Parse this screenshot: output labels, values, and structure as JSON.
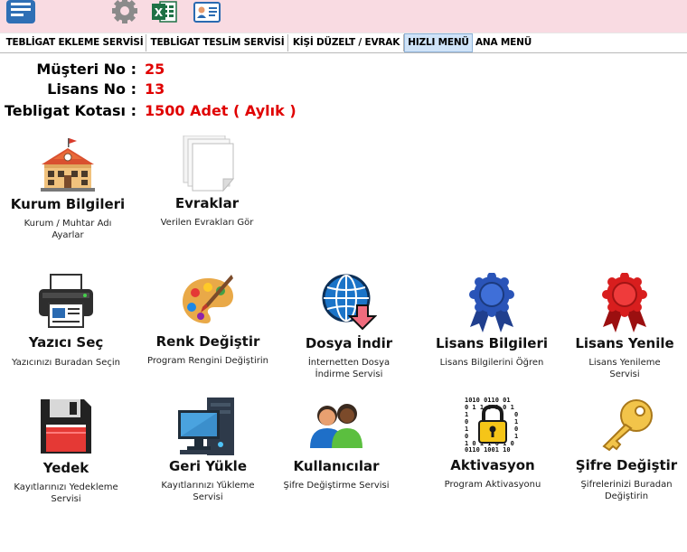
{
  "tabs": [
    {
      "label": "TEBLİGAT EKLEME SERVİSİ"
    },
    {
      "label": "TEBLİGAT TESLİM SERVİSİ"
    },
    {
      "label": "KİŞİ DÜZELT / EVRAK"
    },
    {
      "label": "HIZLI MENÜ"
    },
    {
      "label": "ANA MENÜ"
    }
  ],
  "info": {
    "customer_label": "Müşteri No :",
    "customer_value": "25",
    "license_label": "Lisans No :",
    "license_value": "13",
    "quota_label": "Tebligat Kotası :",
    "quota_value": "1500 Adet ( Aylık )"
  },
  "tiles": [
    {
      "title": "Kurum Bilgileri",
      "desc": "Kurum / Muhtar Adı Ayarlar"
    },
    {
      "title": "Evraklar",
      "desc": "Verilen Evrakları Gör"
    },
    {
      "title": "Yazıcı Seç",
      "desc": "Yazıcınızı Buradan Seçin"
    },
    {
      "title": "Renk Değiştir",
      "desc": "Program Rengini Değiştirin"
    },
    {
      "title": "Dosya İndir",
      "desc": "İnternetten Dosya İndirme Servisi"
    },
    {
      "title": "Lisans Bilgileri",
      "desc": "Lisans Bilgilerini Öğren"
    },
    {
      "title": "Lisans Yenile",
      "desc": "Lisans Yenileme Servisi"
    },
    {
      "title": "Yedek",
      "desc": "Kayıtlarınızı Yedekleme Servisi"
    },
    {
      "title": "Geri Yükle",
      "desc": "Kayıtlarınızı Yükleme Servisi"
    },
    {
      "title": "Kullanıcılar",
      "desc": "Şifre Değiştirme Servisi"
    },
    {
      "title": "Aktivasyon",
      "desc": "Program Aktivasyonu"
    },
    {
      "title": "Şifre Değiştir",
      "desc": "Şifrelerinizi Buradan Değiştirin"
    }
  ],
  "icons": [
    "mail-icon",
    "gear-icon",
    "excel-icon",
    "id-card-icon",
    "school-building-icon",
    "documents-icon",
    "printer-icon",
    "palette-icon",
    "globe-download-icon",
    "blue-award-icon",
    "red-award-icon",
    "floppy-disk-icon",
    "computer-icon",
    "users-icon",
    "padlock-icon",
    "key-icon"
  ]
}
